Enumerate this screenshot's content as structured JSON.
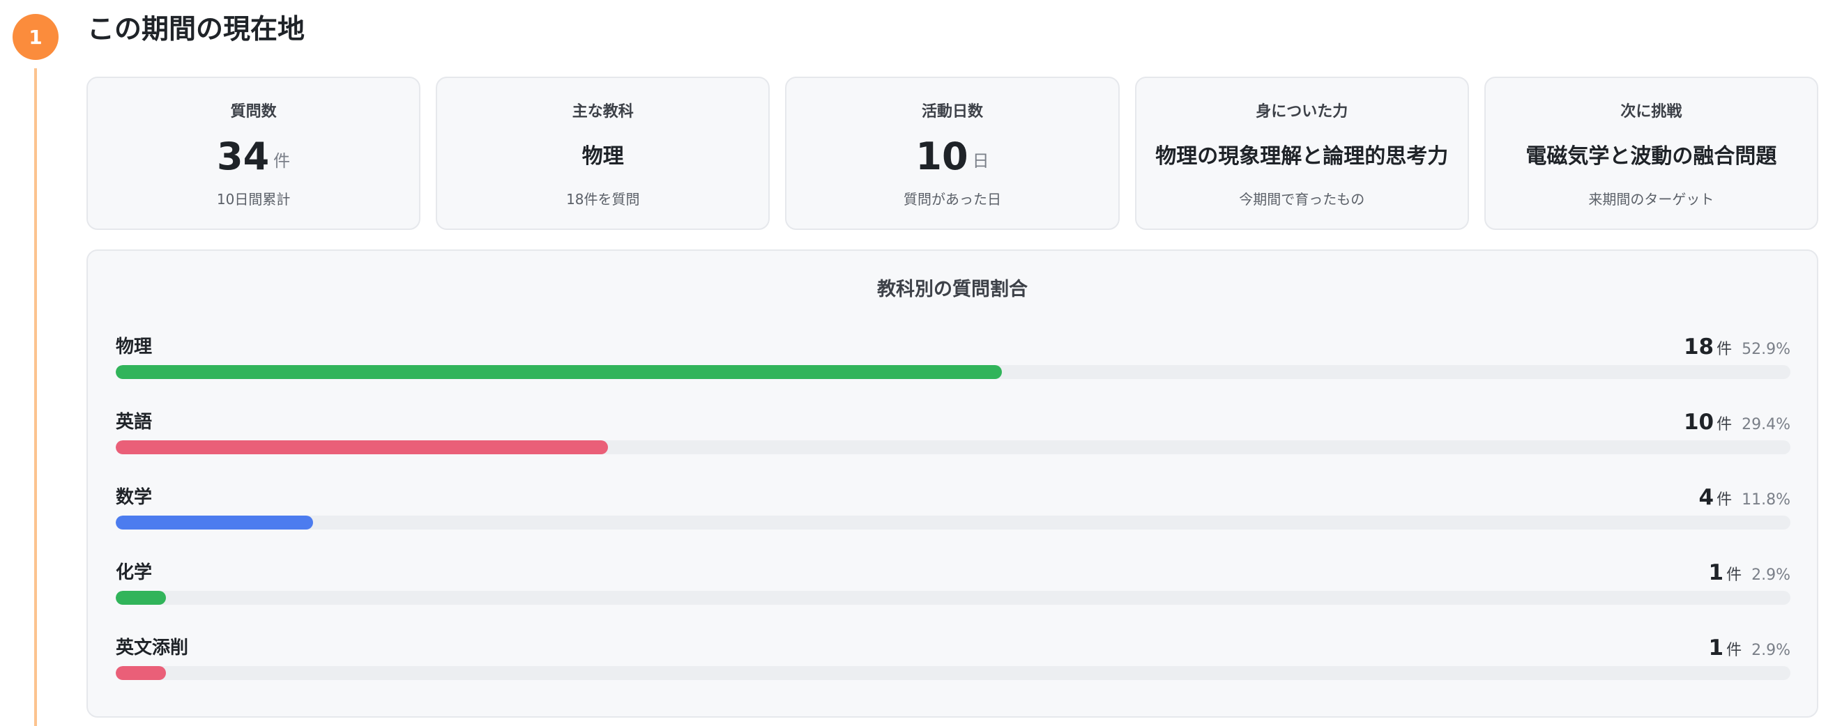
{
  "section": {
    "step_number": "1",
    "title": "この期間の現在地"
  },
  "stats": [
    {
      "label": "質問数",
      "value": "34",
      "unit": "件",
      "sub": "10日間累計"
    },
    {
      "label": "主な教科",
      "value": "物理",
      "unit": "",
      "sub": "18件を質問"
    },
    {
      "label": "活動日数",
      "value": "10",
      "unit": "日",
      "sub": "質問があった日"
    },
    {
      "label": "身についた力",
      "value": "物理の現象理解と論理的思考力",
      "unit": "",
      "sub": "今期間で育ったもの"
    },
    {
      "label": "次に挑戦",
      "value": "電磁気学と波動の融合問題",
      "unit": "",
      "sub": "来期間のターゲット"
    }
  ],
  "subject_panel": {
    "title": "教科別の質問割合",
    "unit": "件"
  },
  "chart_data": {
    "type": "bar",
    "title": "教科別の質問割合",
    "categories": [
      "物理",
      "英語",
      "数学",
      "化学",
      "英文添削"
    ],
    "values": [
      18,
      10,
      4,
      1,
      1
    ],
    "percent_labels": [
      "52.9%",
      "29.4%",
      "11.8%",
      "2.9%",
      "2.9%"
    ],
    "fill_fractions": [
      0.529,
      0.294,
      0.118,
      0.029,
      0.029
    ],
    "colors": [
      "#31b45a",
      "#ea5f78",
      "#4c7cef",
      "#31b45a",
      "#ea5f78"
    ],
    "track_color": "#eceef1"
  },
  "colors": {
    "accent": "#fb8c3c",
    "timeline": "#fcc38f",
    "card_bg": "#f7f8fa",
    "card_border": "#e6e8ec"
  }
}
